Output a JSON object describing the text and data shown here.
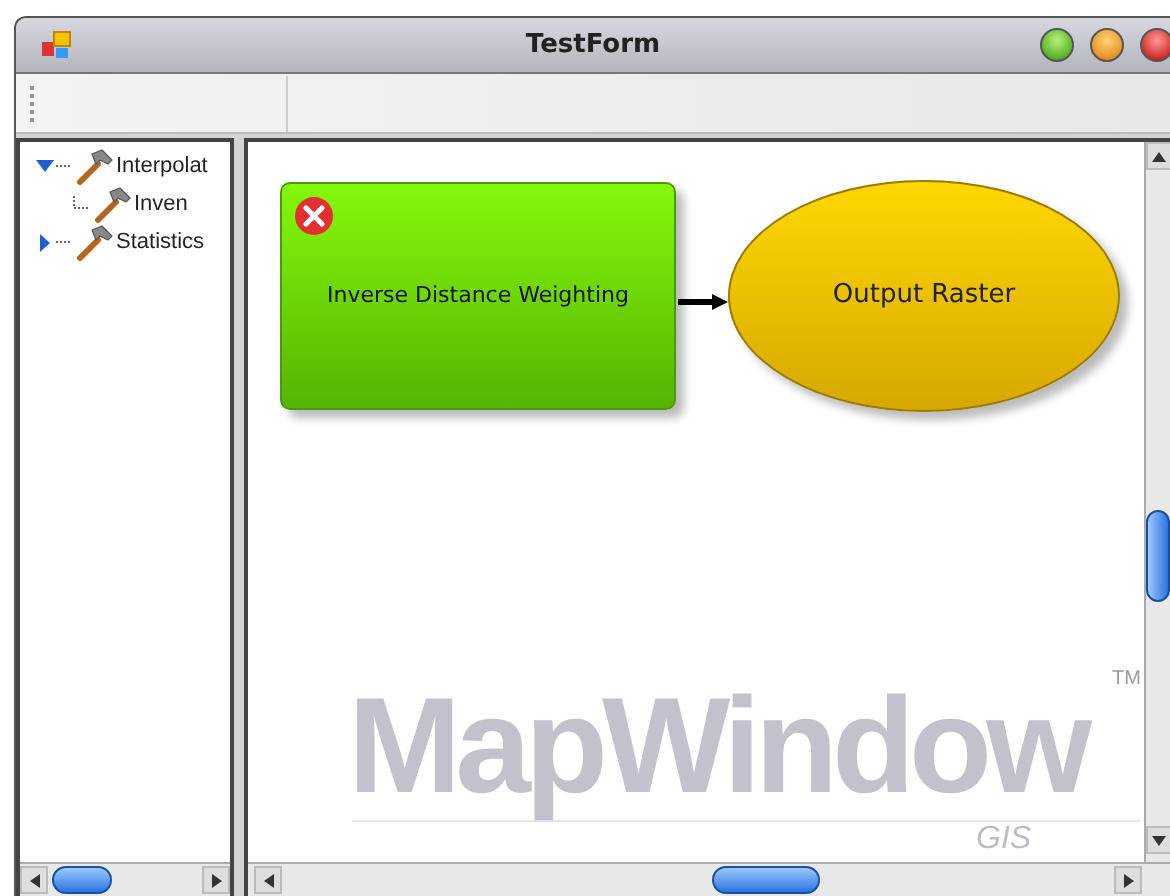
{
  "window": {
    "title": "TestForm"
  },
  "tree": [
    {
      "label": "Interpolat",
      "expanded": true,
      "children": [
        {
          "label": "Inven"
        }
      ]
    },
    {
      "label": "Statistics",
      "expanded": false
    }
  ],
  "canvas": {
    "nodes": [
      {
        "kind": "process",
        "label": "Inverse Distance Weighting",
        "error": true
      },
      {
        "kind": "output",
        "label": "Output Raster"
      }
    ],
    "logo": {
      "name": "MapWindow",
      "sub": "GIS",
      "mark": "TM"
    }
  }
}
